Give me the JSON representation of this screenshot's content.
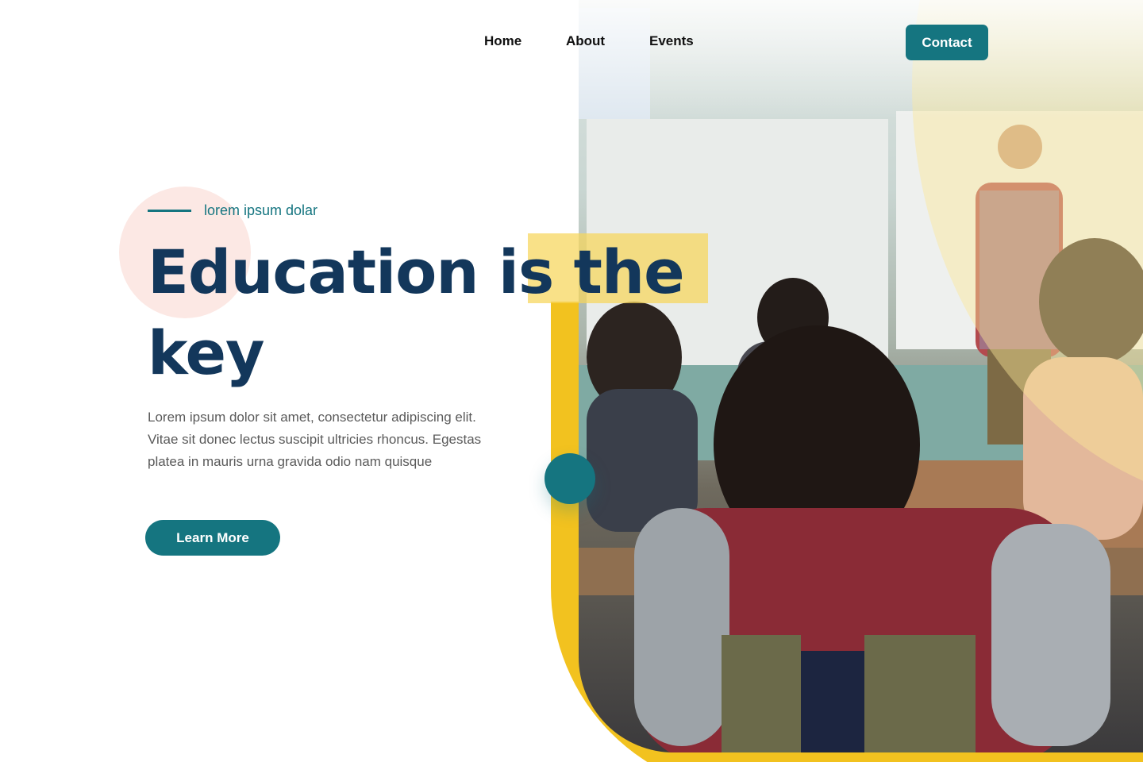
{
  "nav": {
    "links": [
      "Home",
      "About",
      "Events"
    ],
    "contact_label": "Contact"
  },
  "hero": {
    "eyebrow": "lorem ipsum dolar",
    "headline": "Education is the key",
    "body": "Lorem ipsum dolor sit amet, consectetur adipiscing elit. Vitae sit donec lectus suscipit ultricies rhoncus. Egestas platea in mauris urna gravida odio nam quisque",
    "cta_label": "Learn More"
  },
  "colors": {
    "accent": "#157580",
    "headline": "#13375b",
    "yellow": "#f2c21f",
    "pink": "#fce8e4"
  }
}
